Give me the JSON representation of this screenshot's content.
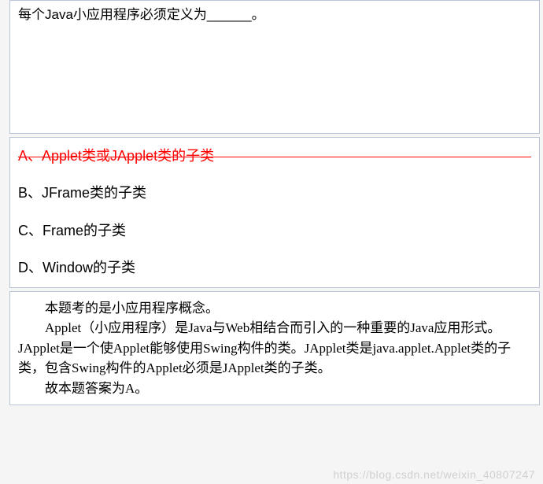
{
  "question": {
    "text": "每个Java小应用程序必须定义为______。"
  },
  "options": [
    {
      "label": "A、",
      "text": "Applet类或JApplet类的子类",
      "correct": true
    },
    {
      "label": "B、",
      "text": "JFrame类的子类",
      "correct": false
    },
    {
      "label": "C、",
      "text": "Frame的子类",
      "correct": false
    },
    {
      "label": "D、",
      "text": "Window的子类",
      "correct": false
    }
  ],
  "explanation": {
    "line1": "本题考的是小应用程序概念。",
    "line2": "Applet（小应用程序）是Java与Web相结合而引入的一种重要的Java应用形式。JApplet是一个使Applet能够使用Swing构件的类。JApplet类是java.applet.Applet类的子类，包含Swing构件的Applet必须是JApplet类的子类。",
    "line3": "故本题答案为A。"
  },
  "watermark": "https://blog.csdn.net/weixin_40807247"
}
